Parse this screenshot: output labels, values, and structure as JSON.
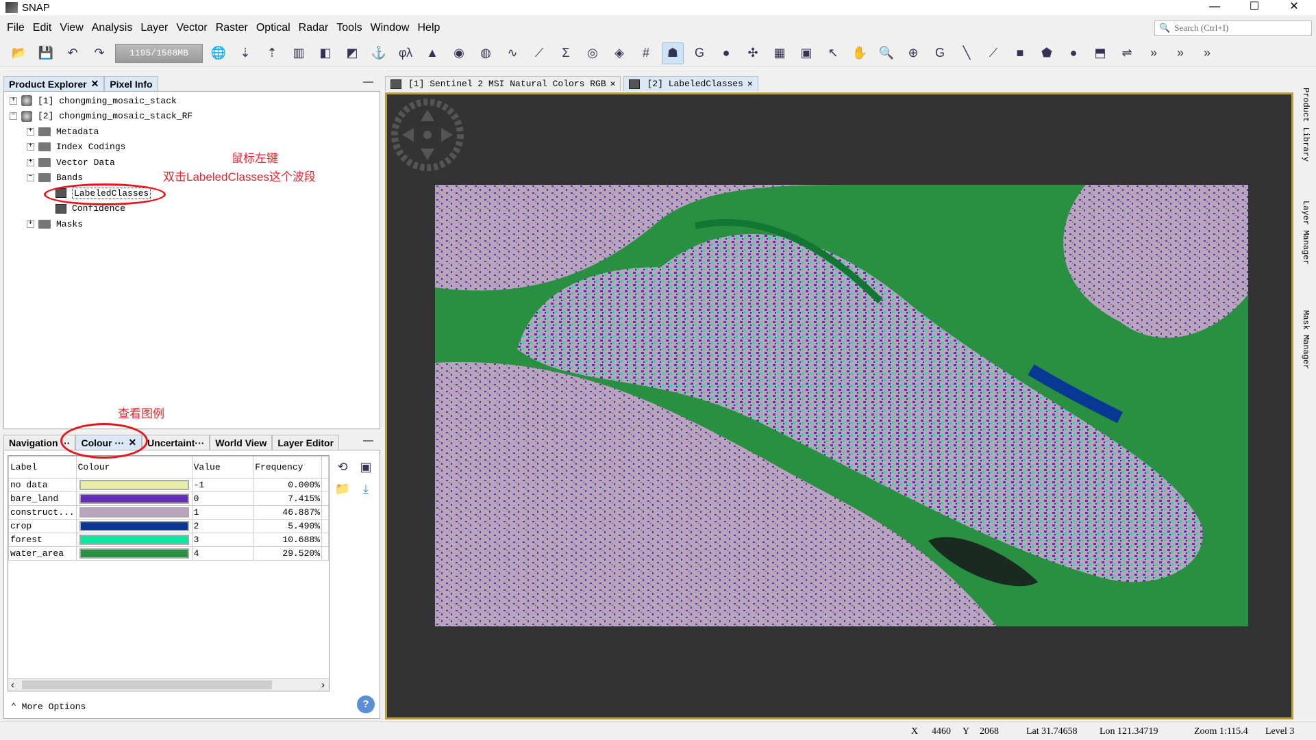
{
  "window": {
    "title": "SNAP",
    "controls": [
      "—",
      "☐",
      "✕"
    ]
  },
  "menu": [
    "File",
    "Edit",
    "View",
    "Analysis",
    "Layer",
    "Vector",
    "Raster",
    "Optical",
    "Radar",
    "Tools",
    "Window",
    "Help"
  ],
  "search": {
    "placeholder": "Search (Ctrl+I)"
  },
  "toolbar": {
    "memory": "1195/1588MB",
    "icons": [
      "open-product",
      "save-product",
      "undo",
      "redo",
      "memory",
      "world",
      "import",
      "export",
      "layers",
      "rgb",
      "band-maths",
      "spectrum",
      "graph",
      "edit",
      "phi-lambda",
      "histogram",
      "globe",
      "scatter",
      "profile",
      "plot",
      "sigma",
      "mask",
      "pin",
      "grid",
      "shapes",
      "gcp",
      "layer",
      "spectra",
      "graticule",
      "overlay",
      "select",
      "pan",
      "zoom",
      "zoom-in",
      "gcp-tool",
      "line",
      "polyline",
      "rectangle",
      "polygon",
      "ellipse",
      "range",
      "more"
    ],
    "icon_glyphs": [
      "📂",
      "💾",
      "↶",
      "↷",
      "🌐",
      "⇣",
      "⇡",
      "▥",
      "◧",
      "◩",
      "⚓",
      "φλ",
      "▲",
      "◉",
      "◍",
      "∿",
      "⟋",
      "Σ",
      "◎",
      "◈",
      "#",
      "☗",
      "G",
      "●",
      "✣",
      "▦",
      "▣",
      "↖",
      "✋",
      "🔍",
      "⊕",
      "G",
      "╲",
      "⟋",
      "■",
      "⬟",
      "●",
      "⬒",
      "⇌",
      "»",
      "»",
      "»"
    ]
  },
  "left_top": {
    "tabs": [
      "Product Explorer",
      "Pixel Info"
    ],
    "tree": [
      {
        "label": "[1] chongming_mosaic_stack",
        "level": 0,
        "exp": "+",
        "type": "db"
      },
      {
        "label": "[2] chongming_mosaic_stack_RF",
        "level": 0,
        "exp": "−",
        "type": "db"
      },
      {
        "label": "Metadata",
        "level": 1,
        "exp": "+",
        "type": "fold"
      },
      {
        "label": "Index Codings",
        "level": 1,
        "exp": "+",
        "type": "fold"
      },
      {
        "label": "Vector Data",
        "level": 1,
        "exp": "+",
        "type": "fold"
      },
      {
        "label": "Bands",
        "level": 1,
        "exp": "−",
        "type": "fold"
      },
      {
        "label": "LabeledClasses",
        "level": 2,
        "exp": "",
        "type": "band"
      },
      {
        "label": "Confidence",
        "level": 2,
        "exp": "",
        "type": "band"
      },
      {
        "label": "Masks",
        "level": 1,
        "exp": "+",
        "type": "fold"
      }
    ]
  },
  "annotations": {
    "a1_line1": "鼠标左键",
    "a1_line2": "双击LabeledClasses这个波段",
    "a2": "查看图例"
  },
  "left_bottom": {
    "tabs": [
      "Navigation ···",
      "Colour ···",
      "Uncertaint···",
      "World View",
      "Layer Editor"
    ],
    "headers": [
      "Label",
      "Colour",
      "Value",
      "Frequency"
    ],
    "rows": [
      {
        "label": "no data",
        "color": "#e8eca8",
        "value": "-1",
        "freq": "0.000%"
      },
      {
        "label": "bare_land",
        "color": "#6030b0",
        "value": "0",
        "freq": "7.415%"
      },
      {
        "label": "construct...",
        "color": "#b8a4bc",
        "value": "1",
        "freq": "46.887%"
      },
      {
        "label": "crop",
        "color": "#083894",
        "value": "2",
        "freq": "5.490%"
      },
      {
        "label": "forest",
        "color": "#08e8a0",
        "value": "3",
        "freq": "10.688%"
      },
      {
        "label": "water_area",
        "color": "#289040",
        "value": "4",
        "freq": "29.520%"
      }
    ],
    "more_options": "More Options"
  },
  "view": {
    "tabs": [
      "[1] Sentinel 2 MSI Natural Colors RGB",
      "[2] LabeledClasses"
    ]
  },
  "right_sidebar": [
    "Product Library",
    "Layer Manager",
    "Mask Manager"
  ],
  "status": {
    "x_label": "X",
    "x": "4460",
    "y_label": "Y",
    "y": "2068",
    "lat": "Lat 31.74658",
    "lon": "Lon 121.34719",
    "zoom": "Zoom 1:115.4",
    "level": "Level 3"
  }
}
